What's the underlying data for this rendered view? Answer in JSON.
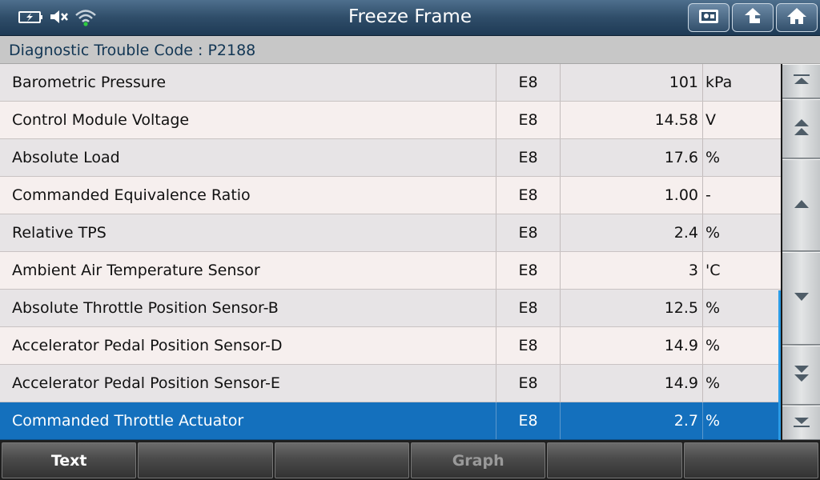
{
  "header": {
    "title": "Freeze Frame"
  },
  "dtc": {
    "label": "Diagnostic Trouble Code : P2188"
  },
  "rows": [
    {
      "name": "Barometric Pressure",
      "code": "E8",
      "value": "101",
      "unit": "kPa"
    },
    {
      "name": "Control Module Voltage",
      "code": "E8",
      "value": "14.58",
      "unit": "V"
    },
    {
      "name": "Absolute Load",
      "code": "E8",
      "value": "17.6",
      "unit": "%"
    },
    {
      "name": "Commanded Equivalence Ratio",
      "code": "E8",
      "value": "1.00",
      "unit": "-"
    },
    {
      "name": "Relative TPS",
      "code": "E8",
      "value": "2.4",
      "unit": "%"
    },
    {
      "name": "Ambient Air Temperature Sensor",
      "code": "E8",
      "value": "3",
      "unit": "'C"
    },
    {
      "name": "Absolute Throttle Position Sensor-B",
      "code": "E8",
      "value": "12.5",
      "unit": "%"
    },
    {
      "name": "Accelerator Pedal Position Sensor-D",
      "code": "E8",
      "value": "14.9",
      "unit": "%"
    },
    {
      "name": "Accelerator Pedal Position Sensor-E",
      "code": "E8",
      "value": "14.9",
      "unit": "%"
    },
    {
      "name": "Commanded Throttle Actuator",
      "code": "E8",
      "value": "2.7",
      "unit": "%"
    }
  ],
  "selected_row": 9,
  "footer": {
    "buttons": [
      {
        "label": "Text",
        "enabled": true
      },
      {
        "label": "",
        "enabled": true
      },
      {
        "label": "",
        "enabled": true
      },
      {
        "label": "Graph",
        "enabled": false
      },
      {
        "label": "",
        "enabled": true
      },
      {
        "label": "",
        "enabled": true
      }
    ]
  },
  "icons": {
    "status": [
      "battery-icon",
      "mute-icon",
      "wifi-icon"
    ],
    "header_buttons": [
      "screenshot-icon",
      "back-icon",
      "home-icon"
    ],
    "scroll": [
      "scroll-top-icon",
      "page-up-icon",
      "scroll-up-icon",
      "scroll-down-icon",
      "page-down-icon",
      "scroll-bottom-icon"
    ]
  },
  "colors": {
    "selected_row": "#1470bd",
    "header": "#2f4d69",
    "wifi_dot": "#2ecc40"
  }
}
